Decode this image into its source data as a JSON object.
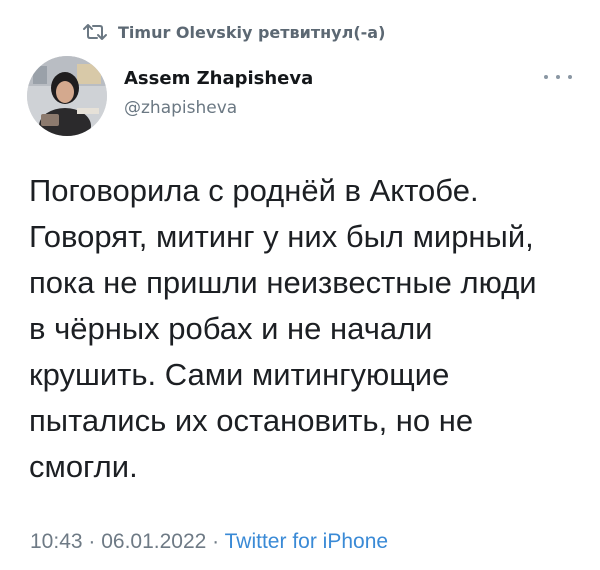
{
  "retweet": {
    "icon": "retweet-icon",
    "text": "Timur Olevskiy ретвитнул(-а)"
  },
  "author": {
    "name": "Assem Zhapisheva",
    "handle": "@zhapisheva",
    "avatar": "avatar-photo"
  },
  "menu": {
    "icon": "more-options-icon"
  },
  "tweet": {
    "lines": [
      "Поговорила с роднёй в Актобе.",
      "Говорят, митинг у них был мирный,",
      "пока не пришли неизвестные люди",
      "в чёрных робах и не начали",
      "крушить. Сами митингующие",
      "пытались их остановить, но не",
      "смогли."
    ]
  },
  "meta": {
    "time": "10:43",
    "separator": " · ",
    "date": "06.01.2022",
    "source": "Twitter for iPhone"
  },
  "colors": {
    "text": "#1c1f23",
    "secondary": "#6e7a85",
    "link": "#3a8ad6"
  }
}
